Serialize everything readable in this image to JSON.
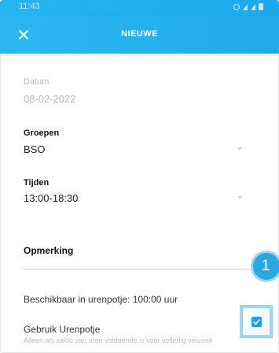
{
  "status_bar": {
    "time": "11:43"
  },
  "app_bar": {
    "title": "NIEUWE",
    "close_icon": "close-icon"
  },
  "form": {
    "datum": {
      "label": "Datum",
      "value": "08-02-2022"
    },
    "groepen": {
      "label": "Groepen",
      "value": "BSO"
    },
    "tijden": {
      "label": "Tijden",
      "value": "13:00-18:30"
    },
    "opmerking": {
      "label": "Opmerking",
      "value": ""
    },
    "beschikbaar": "Beschikbaar in urenpotje: 100:00 uur",
    "gebruik_urenpotje": {
      "label": "Gebruik Urenpotje",
      "hint": "Alleen als saldo van uren voldoende is voor volledig verzoek",
      "checked": true
    }
  },
  "annotation_badge": "1",
  "colors": {
    "accent": "#22aced",
    "badge": "#2ba9de",
    "checkbox": "#1f9fe6"
  }
}
